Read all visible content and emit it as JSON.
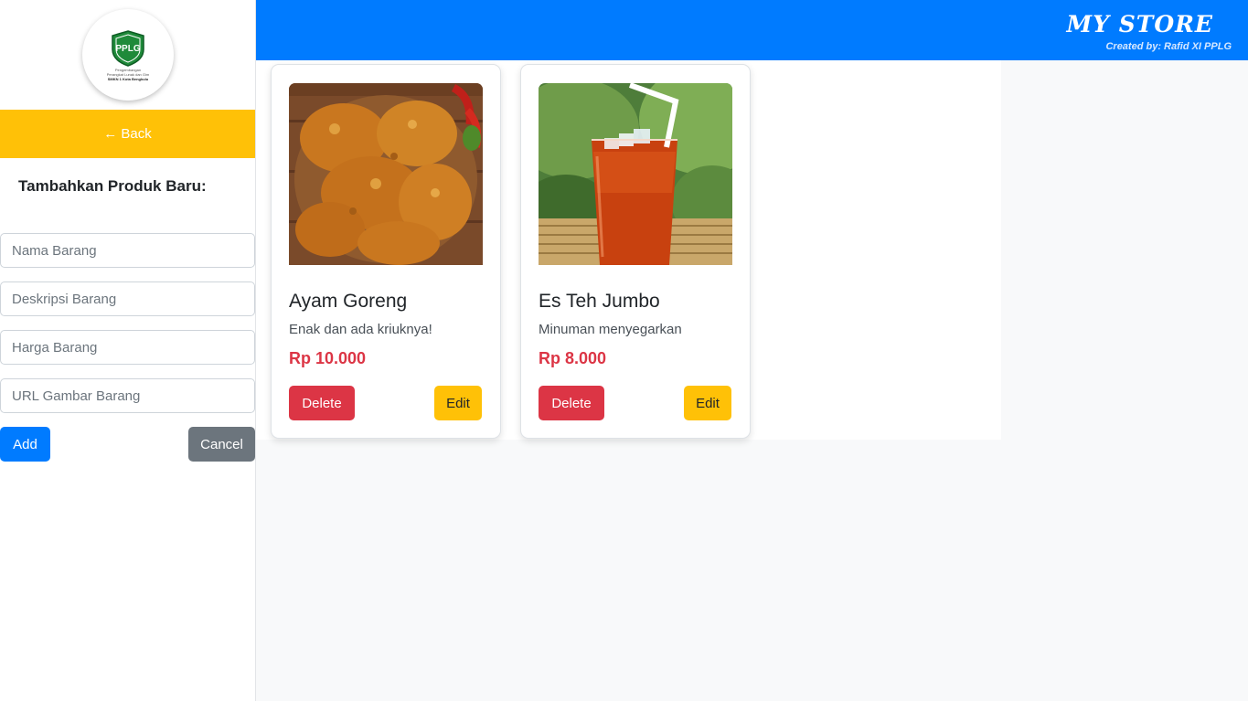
{
  "sidebar": {
    "logo": {
      "icon": "pplg-shield-logo",
      "text": "PPLG",
      "subtitle_line1": "Pengembangan",
      "subtitle_line2": "Perangkat Lunak dan Gim",
      "subtitle_line3": "SMKN 1 Kota Bengkulu"
    },
    "back_label": "← Back",
    "form_title": "Tambahkan Produk Baru:",
    "fields": {
      "name_placeholder": "Nama Barang",
      "desc_placeholder": "Deskripsi Barang",
      "price_placeholder": "Harga Barang",
      "image_placeholder": "URL Gambar Barang"
    },
    "add_label": "Add",
    "cancel_label": "Cancel"
  },
  "header": {
    "brand": "MY STORE",
    "credit": "Created by: Rafid XI PPLG"
  },
  "products": [
    {
      "image": "fried-chicken-photo",
      "title": "Ayam Goreng",
      "description": "Enak dan ada kriuknya!",
      "price": "Rp 10.000",
      "delete_label": "Delete",
      "edit_label": "Edit"
    },
    {
      "image": "iced-tea-photo",
      "title": "Es Teh Jumbo",
      "description": "Minuman menyegarkan",
      "price": "Rp 8.000",
      "delete_label": "Delete",
      "edit_label": "Edit"
    }
  ],
  "colors": {
    "primary": "#007bff",
    "warning": "#ffc107",
    "danger": "#dc3545",
    "secondary": "#6c757d"
  }
}
